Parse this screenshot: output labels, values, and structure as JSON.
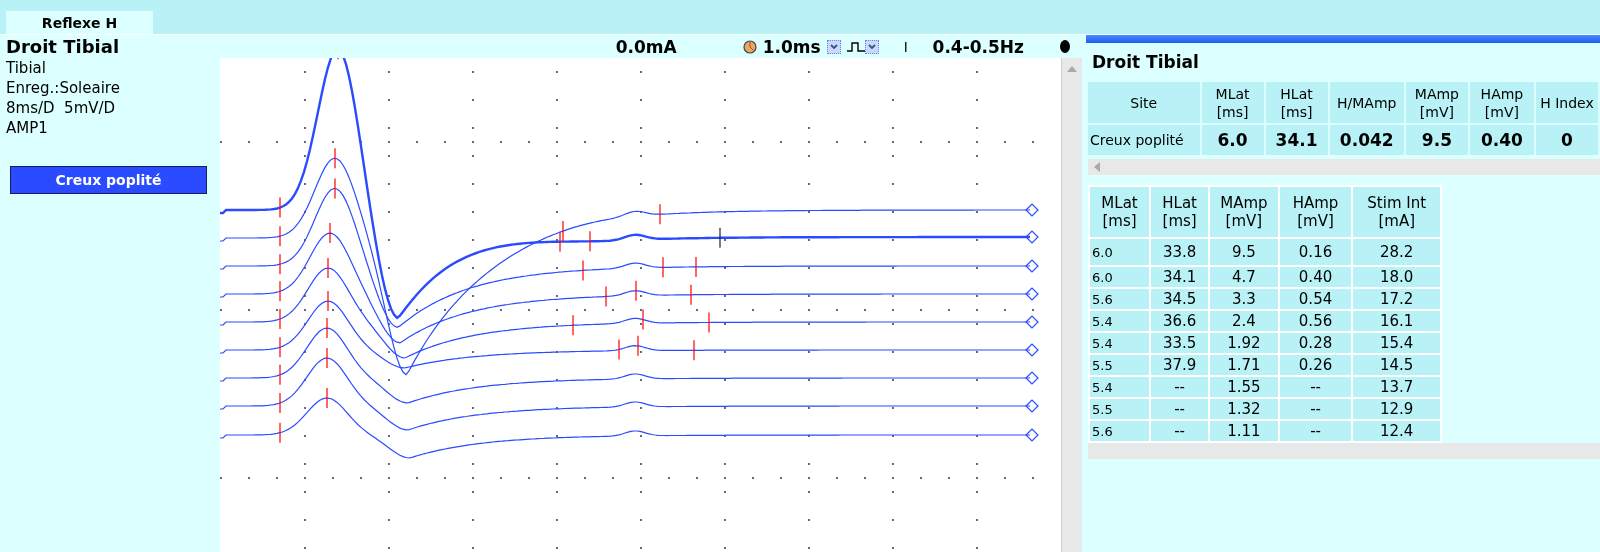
{
  "tab": {
    "label": "Reflexe H",
    "selected": true
  },
  "left_panel": {
    "title": "Droit Tibial",
    "lines": [
      "Tibial",
      "Enreg.:Soleaire",
      "8ms/D  5mV/D",
      "AMP1"
    ],
    "site_button": "Creux poplité"
  },
  "toolbar": {
    "intensity": "0.0mA",
    "duration": "1.0ms",
    "filter": "0.4-0.5Hz"
  },
  "results": {
    "title": "Droit Tibial",
    "summary": {
      "columns": [
        {
          "name": "Site"
        },
        {
          "name": "MLat",
          "unit": "[ms]"
        },
        {
          "name": "HLat",
          "unit": "[ms]"
        },
        {
          "name": "H/MAmp"
        },
        {
          "name": "MAmp",
          "unit": "[mV]"
        },
        {
          "name": "HAmp",
          "unit": "[mV]"
        },
        {
          "name": "H Index"
        }
      ],
      "rows": [
        [
          "Creux poplité",
          "6.0",
          "34.1",
          "0.042",
          "9.5",
          "0.40",
          "0"
        ]
      ]
    },
    "trials": {
      "columns": [
        {
          "name": "MLat",
          "unit": "[ms]"
        },
        {
          "name": "HLat",
          "unit": "[ms]"
        },
        {
          "name": "MAmp",
          "unit": "[mV]"
        },
        {
          "name": "HAmp",
          "unit": "[mV]"
        },
        {
          "name": "Stim Int",
          "unit": "[mA]"
        }
      ],
      "rows": [
        [
          "6.0",
          "33.8",
          "9.5",
          "0.16",
          "28.2"
        ],
        [
          "6.0",
          "34.1",
          "4.7",
          "0.40",
          "18.0"
        ],
        [
          "5.6",
          "34.5",
          "3.3",
          "0.54",
          "17.2"
        ],
        [
          "5.4",
          "36.6",
          "2.4",
          "0.56",
          "16.1"
        ],
        [
          "5.4",
          "33.5",
          "1.92",
          "0.28",
          "15.4"
        ],
        [
          "5.5",
          "37.9",
          "1.71",
          "0.26",
          "14.5"
        ],
        [
          "5.4",
          "--",
          "1.55",
          "--",
          "13.7"
        ],
        [
          "5.5",
          "--",
          "1.32",
          "--",
          "12.9"
        ],
        [
          "5.6",
          "--",
          "1.11",
          "--",
          "12.4"
        ]
      ]
    }
  }
}
